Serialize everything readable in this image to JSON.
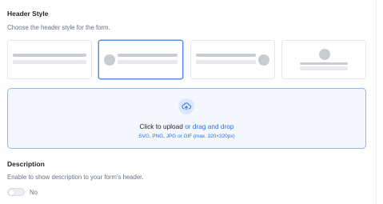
{
  "header_style": {
    "title": "Header Style",
    "description": "Choose the header style for the form.",
    "options": [
      {
        "name": "No icon",
        "selected": false
      },
      {
        "name": "Icon left",
        "selected": true
      },
      {
        "name": "Icon right",
        "selected": false
      },
      {
        "name": "Icon centered",
        "selected": false
      }
    ]
  },
  "upload": {
    "icon": "cloud-upload-icon",
    "click_text": "Click to upload",
    "drag_text": "or drag and drop",
    "hint": "SVG, PNG, JPG or GIF (max. 320×320px)"
  },
  "description_section": {
    "title": "Description",
    "description": "Enable to show description to your form's header.",
    "toggle_label": "No",
    "toggle_on": false
  },
  "colors": {
    "accent": "#2f6fd6",
    "selected_border": "#5b8def",
    "upload_bg": "#f4f8fe",
    "placeholder_gray": "#c9ccd1"
  }
}
